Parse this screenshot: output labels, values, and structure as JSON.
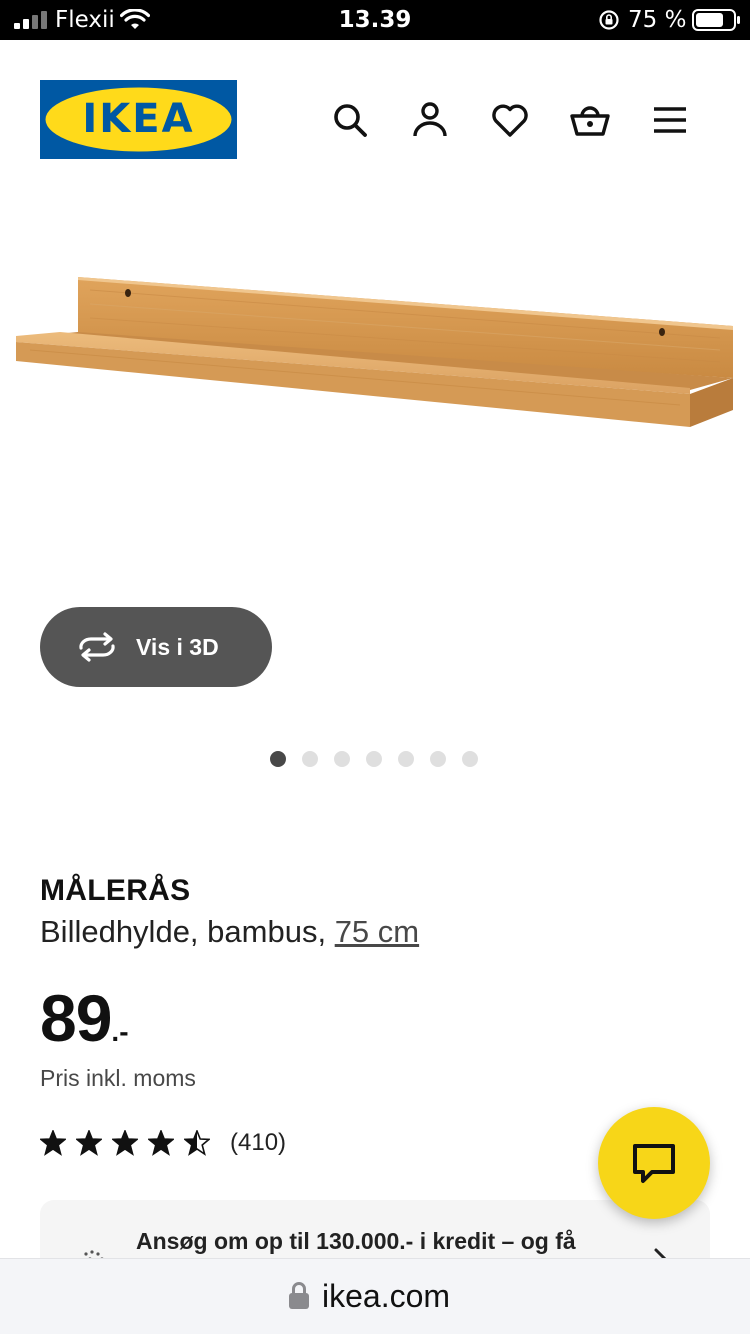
{
  "status_bar": {
    "carrier": "Flexii",
    "time": "13.39",
    "battery_percent": "75 %",
    "battery_level": 0.75,
    "icons": [
      "signal-icon",
      "wifi-icon",
      "rotation-lock-icon",
      "battery-icon"
    ]
  },
  "header": {
    "logo_text": "IKEA",
    "logo_colors": {
      "background": "#0058a3",
      "ellipse": "#ffda1a",
      "text": "#0058a3"
    },
    "icons": [
      "search-icon",
      "account-icon",
      "heart-icon",
      "basket-icon",
      "menu-icon"
    ]
  },
  "gallery": {
    "view_3d_label": "Vis i 3D",
    "slide_count": 7,
    "active_slide": 1
  },
  "product": {
    "name": "MÅLERÅS",
    "description": "Billedhylde, bambus,",
    "size": "75 cm",
    "price_integer": "89",
    "price_decimal": ".-",
    "price_note": "Pris inkl. moms",
    "rating": 4.5,
    "review_count": "(410)"
  },
  "credit_banner": {
    "text": "Ansøg om op til 130.000.- i kredit – og få"
  },
  "browser": {
    "url": "ikea.com"
  },
  "colors": {
    "accent_yellow": "#f7d618",
    "dark_button": "#555555",
    "ikea_blue": "#0058a3"
  }
}
